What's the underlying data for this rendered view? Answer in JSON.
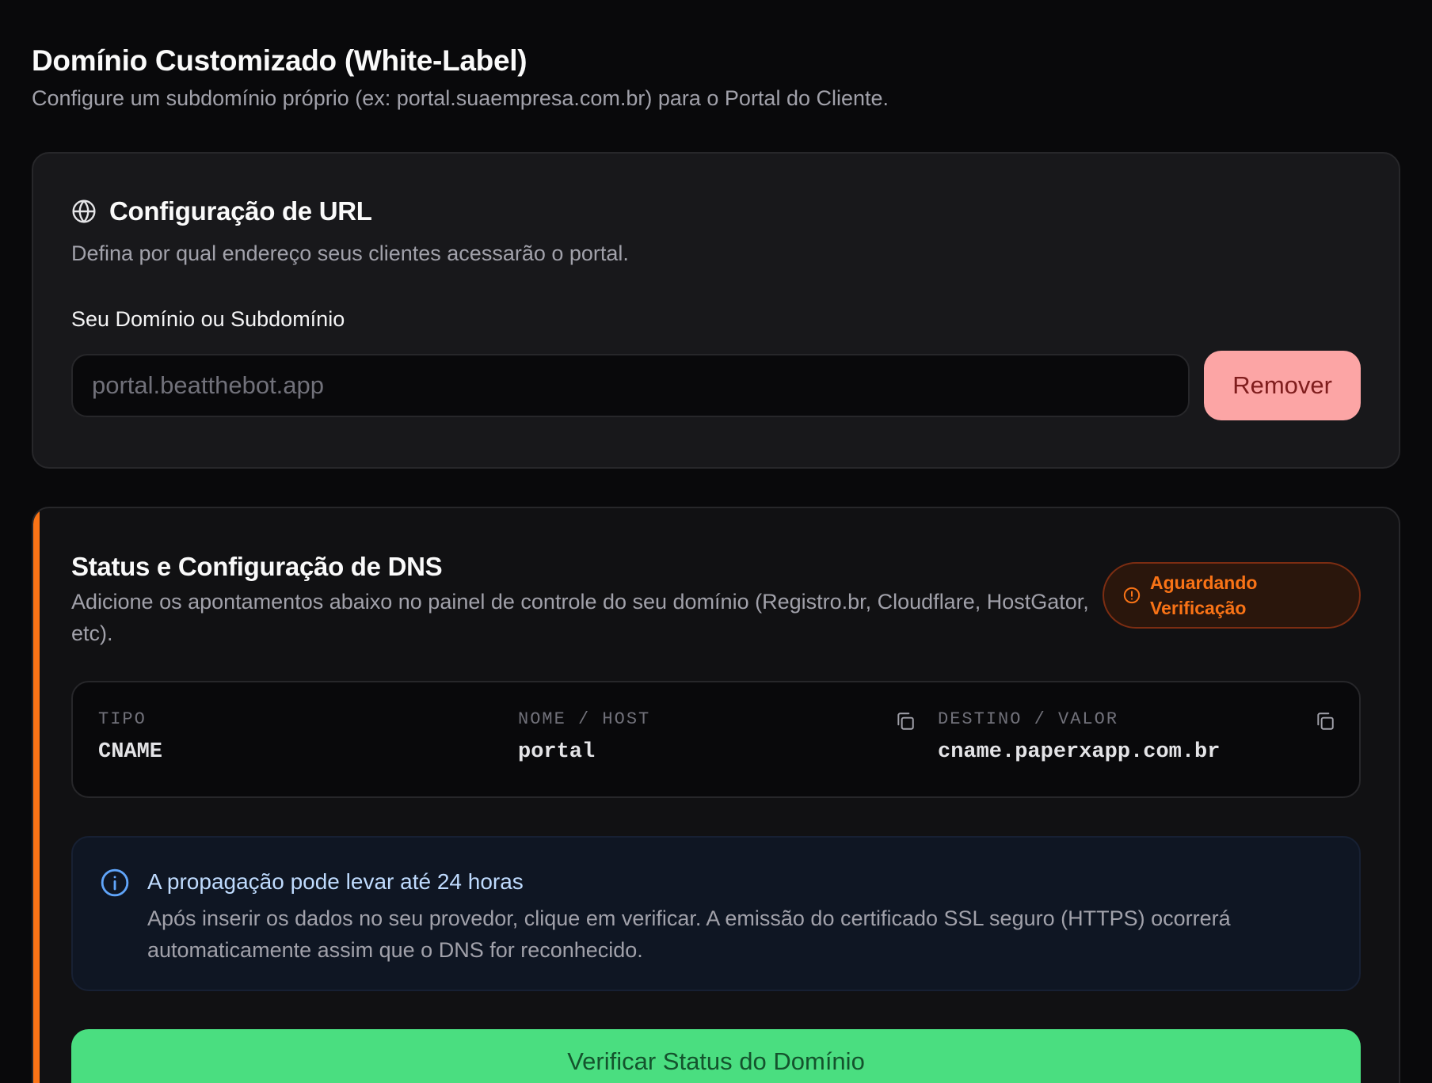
{
  "header": {
    "title": "Domínio Customizado (White-Label)",
    "subtitle": "Configure um subdomínio próprio (ex: portal.suaempresa.com.br) para o Portal do Cliente."
  },
  "url_card": {
    "icon": "globe-icon",
    "title": "Configuração de URL",
    "description": "Defina por qual endereço seus clientes acessarão o portal.",
    "field_label": "Seu Domínio ou Subdomínio",
    "input_value": "",
    "input_placeholder": "portal.beatthebot.app",
    "remove_label": "Remover"
  },
  "dns_card": {
    "accent_color": "#f97316",
    "title": "Status e Configuração de DNS",
    "description": "Adicione os apontamentos abaixo no painel de controle do seu domínio (Registro.br, Cloudflare, HostGator, etc).",
    "status": {
      "icon": "alert-circle-icon",
      "label": "Aguardando\nVerificação",
      "color": "#f97316"
    },
    "record": {
      "type_header": "TIPO",
      "type_value": "CNAME",
      "host_header": "NOME / HOST",
      "host_value": "portal",
      "value_header": "DESTINO / VALOR",
      "value_value": "cname.paperxapp.com.br"
    },
    "info": {
      "icon": "info-icon",
      "title": "A propagação pode levar até 24 horas",
      "description": "Após inserir os dados no seu provedor, clique em verificar. A emissão do certificado SSL seguro (HTTPS) ocorrerá automaticamente assim que o DNS for reconhecido."
    },
    "verify_label": "Verificar Status do Domínio",
    "verify_color": "#4ade80"
  }
}
